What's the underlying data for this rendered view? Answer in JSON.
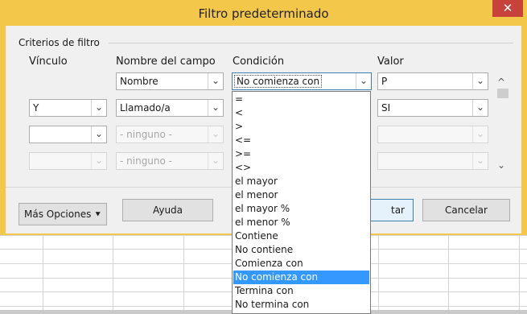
{
  "dialog": {
    "title": "Filtro predeterminado",
    "close_glyph": "✕",
    "group_label": "Criterios de filtro",
    "columns": {
      "vinculo": "Vínculo",
      "campo": "Nombre del campo",
      "condicion": "Condición",
      "valor": "Valor"
    },
    "rows": [
      {
        "link": "",
        "field": "Nombre",
        "condition": "No comienza con",
        "value": "P"
      },
      {
        "link": "Y",
        "field": "Llamado/a",
        "condition": "",
        "value": "SI"
      },
      {
        "link": "",
        "field": "- ninguno -",
        "condition": "",
        "value": ""
      },
      {
        "link": "",
        "field": "- ninguno -",
        "condition": "",
        "value": ""
      }
    ],
    "buttons": {
      "more_options": "Más Opciones",
      "help": "Ayuda",
      "ok_fragment": "tar",
      "cancel": "Cancelar"
    },
    "icons": {
      "dropdown_arrow": "⌄",
      "scroll_up": "^",
      "scroll_down": "⌄",
      "more_arrow": "⯆"
    }
  },
  "condition_dropdown": {
    "options": [
      "=",
      "<",
      ">",
      "<=",
      ">=",
      "<>",
      "el mayor",
      "el menor",
      "el mayor %",
      "el menor %",
      "Contiene",
      "No contiene",
      "Comienza con",
      "No comienza con",
      "Termina con",
      "No termina con"
    ],
    "selected": "No comienza con"
  },
  "colors": {
    "frame": "#f3c84a",
    "close": "#c7423a",
    "selection": "#3399ff"
  }
}
